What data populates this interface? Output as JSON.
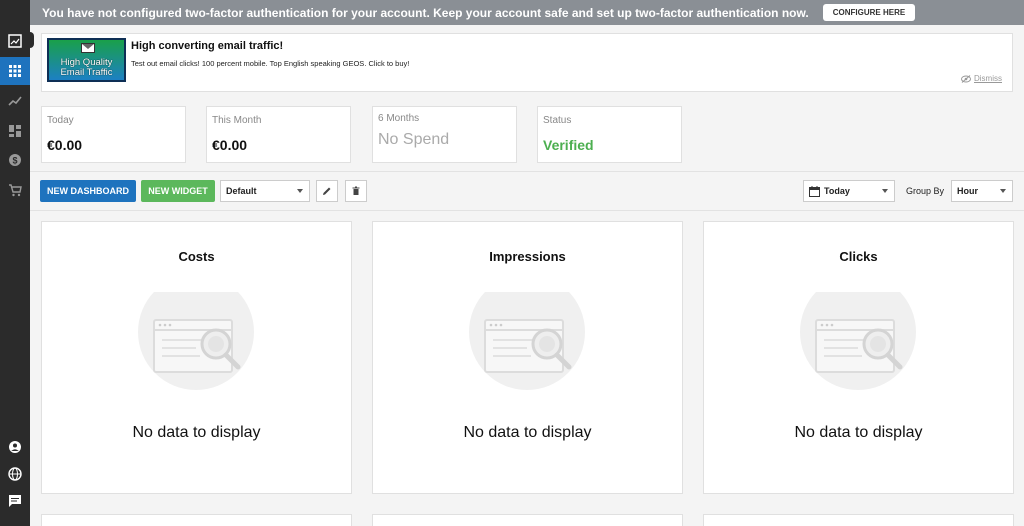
{
  "banner": {
    "message": "You have not configured two-factor authentication for your account. Keep your account safe and set up two-factor authentication now.",
    "configure_label": "CONFIGURE HERE"
  },
  "sidebar": {
    "items": [
      {
        "icon": "image-icon"
      },
      {
        "icon": "grid-icon",
        "active": true
      },
      {
        "icon": "trending-icon"
      },
      {
        "icon": "dashboard-icon"
      },
      {
        "icon": "dollar-icon"
      },
      {
        "icon": "cart-icon"
      },
      {
        "icon": "account-icon"
      },
      {
        "icon": "globe-icon"
      },
      {
        "icon": "chat-icon"
      }
    ]
  },
  "ad": {
    "image_text": [
      "High Quality",
      "Email Traffic"
    ],
    "title": "High converting email traffic!",
    "description": "Test out email clicks! 100 percent mobile. Top English speaking GEOS. Click to buy!",
    "dismiss_label": "Dismiss"
  },
  "stats": [
    {
      "label": "Today",
      "value": "€0.00"
    },
    {
      "label": "This Month",
      "value": "€0.00"
    },
    {
      "label": "6 Months",
      "value": "No Spend"
    },
    {
      "label": "Status",
      "value": "Verified"
    }
  ],
  "toolbar": {
    "new_dashboard_label": "NEW DASHBOARD",
    "new_widget_label": "NEW WIDGET",
    "dashboard_select": "Default",
    "date_range": "Today",
    "group_by_label": "Group By",
    "group_by_value": "Hour"
  },
  "widgets": [
    {
      "title": "Costs",
      "empty_text": "No data to display"
    },
    {
      "title": "Impressions",
      "empty_text": "No data to display"
    },
    {
      "title": "Clicks",
      "empty_text": "No data to display"
    }
  ],
  "colors": {
    "primary": "#1e73be",
    "success": "#5cb85c",
    "verified": "#4caf50",
    "banner": "#8a8f95",
    "sidebar": "#2b2b2b"
  }
}
